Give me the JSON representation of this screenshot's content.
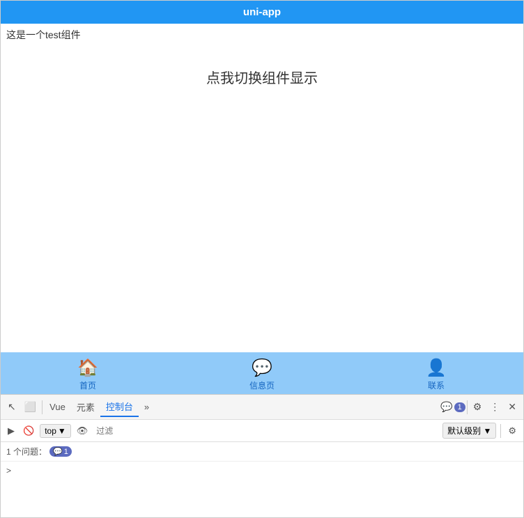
{
  "titleBar": {
    "label": "uni-app"
  },
  "app": {
    "topLabel": "这是一个test组件",
    "switchBtn": "点我切换组件显示"
  },
  "navBar": {
    "items": [
      {
        "id": "home",
        "label": "首页",
        "icon": "🏠"
      },
      {
        "id": "message",
        "label": "信息页",
        "icon": "💬"
      },
      {
        "id": "contact",
        "label": "联系",
        "icon": "👤"
      }
    ]
  },
  "devtools": {
    "tabs": [
      {
        "id": "vue",
        "label": "Vue"
      },
      {
        "id": "elements",
        "label": "元素"
      },
      {
        "id": "console",
        "label": "控制台",
        "active": true
      },
      {
        "id": "more",
        "label": "»"
      }
    ],
    "badgeCount": "1",
    "filterPlaceholder": "过滤",
    "topDropdown": "top",
    "levelDropdown": "默认级别",
    "issuesText": "1 个问题：",
    "issueBadge": "1",
    "icons": {
      "cursor": "↖",
      "box": "⬜",
      "settings": "⚙",
      "more": "⋮",
      "close": "✕",
      "play": "▶",
      "block": "🚫",
      "eye": "👁",
      "gear2": "⚙"
    }
  }
}
